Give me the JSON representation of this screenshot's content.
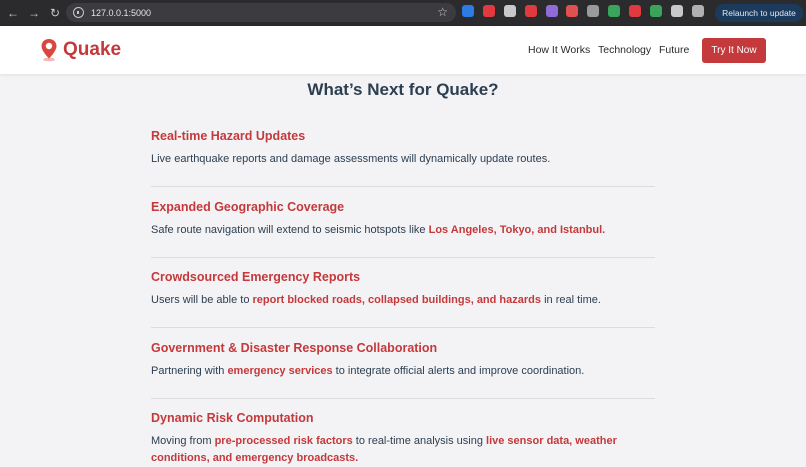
{
  "browser": {
    "url": "127.0.0.1:5000",
    "relaunch_label": "Relaunch to update",
    "extension_colors": [
      "#2d7be5",
      "#e0393e",
      "#c8c8c8",
      "#e0393e",
      "#8e6bd8",
      "#e05050",
      "#9a9a9a",
      "#3aa55a",
      "#e0393e",
      "#3aa55a",
      "#c8c8c8",
      "#b0b0b0"
    ]
  },
  "header": {
    "brand": "Quake",
    "brand_color": "#c4393b",
    "nav": [
      "How It Works",
      "Technology",
      "Future"
    ],
    "cta": "Try It Now"
  },
  "main": {
    "title": "What’s Next for Quake?",
    "features": [
      {
        "title": "Real-time Hazard Updates",
        "desc": [
          {
            "t": "Live earthquake reports and damage assessments will dynamically update routes."
          }
        ]
      },
      {
        "title": "Expanded Geographic Coverage",
        "desc": [
          {
            "t": "Safe route navigation will extend to seismic hotspots like "
          },
          {
            "t": "Los Angeles, Tokyo, and Istanbul.",
            "hl": true
          }
        ]
      },
      {
        "title": "Crowdsourced Emergency Reports",
        "desc": [
          {
            "t": "Users will be able to "
          },
          {
            "t": "report blocked roads, collapsed buildings, and hazards",
            "hl": true
          },
          {
            "t": " in real time."
          }
        ]
      },
      {
        "title": "Government & Disaster Response Collaboration",
        "desc": [
          {
            "t": "Partnering with "
          },
          {
            "t": "emergency services",
            "hl": true
          },
          {
            "t": " to integrate official alerts and improve coordination."
          }
        ]
      },
      {
        "title": "Dynamic Risk Computation",
        "desc": [
          {
            "t": "Moving from "
          },
          {
            "t": "pre-processed risk factors",
            "hl": true
          },
          {
            "t": " to real-time analysis using "
          },
          {
            "t": "live sensor data, weather conditions, and emergency broadcasts.",
            "hl": true
          }
        ]
      }
    ]
  }
}
